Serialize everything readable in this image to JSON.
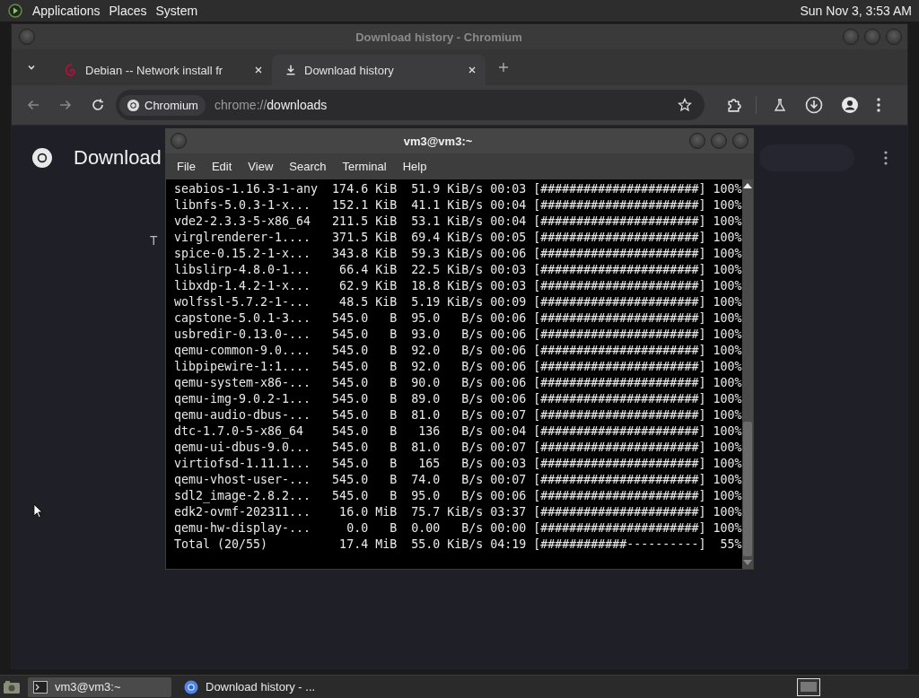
{
  "top_panel": {
    "menus": [
      "Applications",
      "Places",
      "System"
    ],
    "clock": "Sun Nov 3, 3:53 AM"
  },
  "browser": {
    "title": "Download history - Chromium",
    "tabs": [
      {
        "label": "Debian -- Network install fr",
        "selected": false,
        "kind": "web"
      },
      {
        "label": "Download history",
        "selected": true,
        "kind": "download"
      }
    ],
    "omnibox": {
      "chip": "Chromium",
      "scheme": "chrome://",
      "path": "downloads"
    },
    "page": {
      "heading": "Download",
      "partial_text": "T"
    }
  },
  "terminal": {
    "title": "vm3@vm3:~",
    "menus": [
      "File",
      "Edit",
      "View",
      "Search",
      "Terminal",
      "Help"
    ],
    "rows": [
      {
        "name": "seabios-1.16.3-1-any",
        "size": "174.6",
        "unit": "KiB",
        "rate": "51.9",
        "rate_unit": "KiB/s",
        "eta": "00:03",
        "bar": "[######################]",
        "percent": "100%"
      },
      {
        "name": "libnfs-5.0.3-1-x...",
        "size": "152.1",
        "unit": "KiB",
        "rate": "41.1",
        "rate_unit": "KiB/s",
        "eta": "00:04",
        "bar": "[######################]",
        "percent": "100%"
      },
      {
        "name": "vde2-2.3.3-5-x86_64",
        "size": "211.5",
        "unit": "KiB",
        "rate": "53.1",
        "rate_unit": "KiB/s",
        "eta": "00:04",
        "bar": "[######################]",
        "percent": "100%"
      },
      {
        "name": "virglrenderer-1....",
        "size": "371.5",
        "unit": "KiB",
        "rate": "69.4",
        "rate_unit": "KiB/s",
        "eta": "00:05",
        "bar": "[######################]",
        "percent": "100%"
      },
      {
        "name": "spice-0.15.2-1-x...",
        "size": "343.8",
        "unit": "KiB",
        "rate": "59.3",
        "rate_unit": "KiB/s",
        "eta": "00:06",
        "bar": "[######################]",
        "percent": "100%"
      },
      {
        "name": "libslirp-4.8.0-1...",
        "size": "66.4",
        "unit": "KiB",
        "rate": "22.5",
        "rate_unit": "KiB/s",
        "eta": "00:03",
        "bar": "[######################]",
        "percent": "100%"
      },
      {
        "name": "libxdp-1.4.2-1-x...",
        "size": "62.9",
        "unit": "KiB",
        "rate": "18.8",
        "rate_unit": "KiB/s",
        "eta": "00:03",
        "bar": "[######################]",
        "percent": "100%"
      },
      {
        "name": "wolfssl-5.7.2-1-...",
        "size": "48.5",
        "unit": "KiB",
        "rate": "5.19",
        "rate_unit": "KiB/s",
        "eta": "00:09",
        "bar": "[######################]",
        "percent": "100%"
      },
      {
        "name": "capstone-5.0.1-3...",
        "size": "545.0",
        "unit": "B",
        "rate": "95.0",
        "rate_unit": "B/s",
        "eta": "00:06",
        "bar": "[######################]",
        "percent": "100%"
      },
      {
        "name": "usbredir-0.13.0-...",
        "size": "545.0",
        "unit": "B",
        "rate": "93.0",
        "rate_unit": "B/s",
        "eta": "00:06",
        "bar": "[######################]",
        "percent": "100%"
      },
      {
        "name": "qemu-common-9.0....",
        "size": "545.0",
        "unit": "B",
        "rate": "92.0",
        "rate_unit": "B/s",
        "eta": "00:06",
        "bar": "[######################]",
        "percent": "100%"
      },
      {
        "name": "libpipewire-1:1....",
        "size": "545.0",
        "unit": "B",
        "rate": "92.0",
        "rate_unit": "B/s",
        "eta": "00:06",
        "bar": "[######################]",
        "percent": "100%"
      },
      {
        "name": "qemu-system-x86-...",
        "size": "545.0",
        "unit": "B",
        "rate": "90.0",
        "rate_unit": "B/s",
        "eta": "00:06",
        "bar": "[######################]",
        "percent": "100%"
      },
      {
        "name": "qemu-img-9.0.2-1...",
        "size": "545.0",
        "unit": "B",
        "rate": "89.0",
        "rate_unit": "B/s",
        "eta": "00:06",
        "bar": "[######################]",
        "percent": "100%"
      },
      {
        "name": "qemu-audio-dbus-...",
        "size": "545.0",
        "unit": "B",
        "rate": "81.0",
        "rate_unit": "B/s",
        "eta": "00:07",
        "bar": "[######################]",
        "percent": "100%"
      },
      {
        "name": "dtc-1.7.0-5-x86_64",
        "size": "545.0",
        "unit": "B",
        "rate": "136",
        "rate_unit": "B/s",
        "eta": "00:04",
        "bar": "[######################]",
        "percent": "100%"
      },
      {
        "name": "qemu-ui-dbus-9.0...",
        "size": "545.0",
        "unit": "B",
        "rate": "81.0",
        "rate_unit": "B/s",
        "eta": "00:07",
        "bar": "[######################]",
        "percent": "100%"
      },
      {
        "name": "virtiofsd-1.11.1...",
        "size": "545.0",
        "unit": "B",
        "rate": "165",
        "rate_unit": "B/s",
        "eta": "00:03",
        "bar": "[######################]",
        "percent": "100%"
      },
      {
        "name": "qemu-vhost-user-...",
        "size": "545.0",
        "unit": "B",
        "rate": "74.0",
        "rate_unit": "B/s",
        "eta": "00:07",
        "bar": "[######################]",
        "percent": "100%"
      },
      {
        "name": "sdl2_image-2.8.2...",
        "size": "545.0",
        "unit": "B",
        "rate": "95.0",
        "rate_unit": "B/s",
        "eta": "00:06",
        "bar": "[######################]",
        "percent": "100%"
      },
      {
        "name": "edk2-ovmf-202311...",
        "size": "16.0",
        "unit": "MiB",
        "rate": "75.7",
        "rate_unit": "KiB/s",
        "eta": "03:37",
        "bar": "[######################]",
        "percent": "100%"
      },
      {
        "name": "qemu-hw-display-...",
        "size": "0.0",
        "unit": "B",
        "rate": "0.00",
        "rate_unit": "B/s",
        "eta": "00:00",
        "bar": "[######################]",
        "percent": "100%"
      },
      {
        "name": "Total (20/55)",
        "size": "17.4",
        "unit": "MiB",
        "rate": "55.0",
        "rate_unit": "KiB/s",
        "eta": "04:19",
        "bar": "[############----------]",
        "percent": "55%"
      }
    ]
  },
  "taskbar": {
    "tasks": [
      {
        "label": "vm3@vm3:~",
        "selected": true,
        "kind": "terminal"
      },
      {
        "label": "Download history - ...",
        "selected": false,
        "kind": "browser"
      }
    ]
  }
}
